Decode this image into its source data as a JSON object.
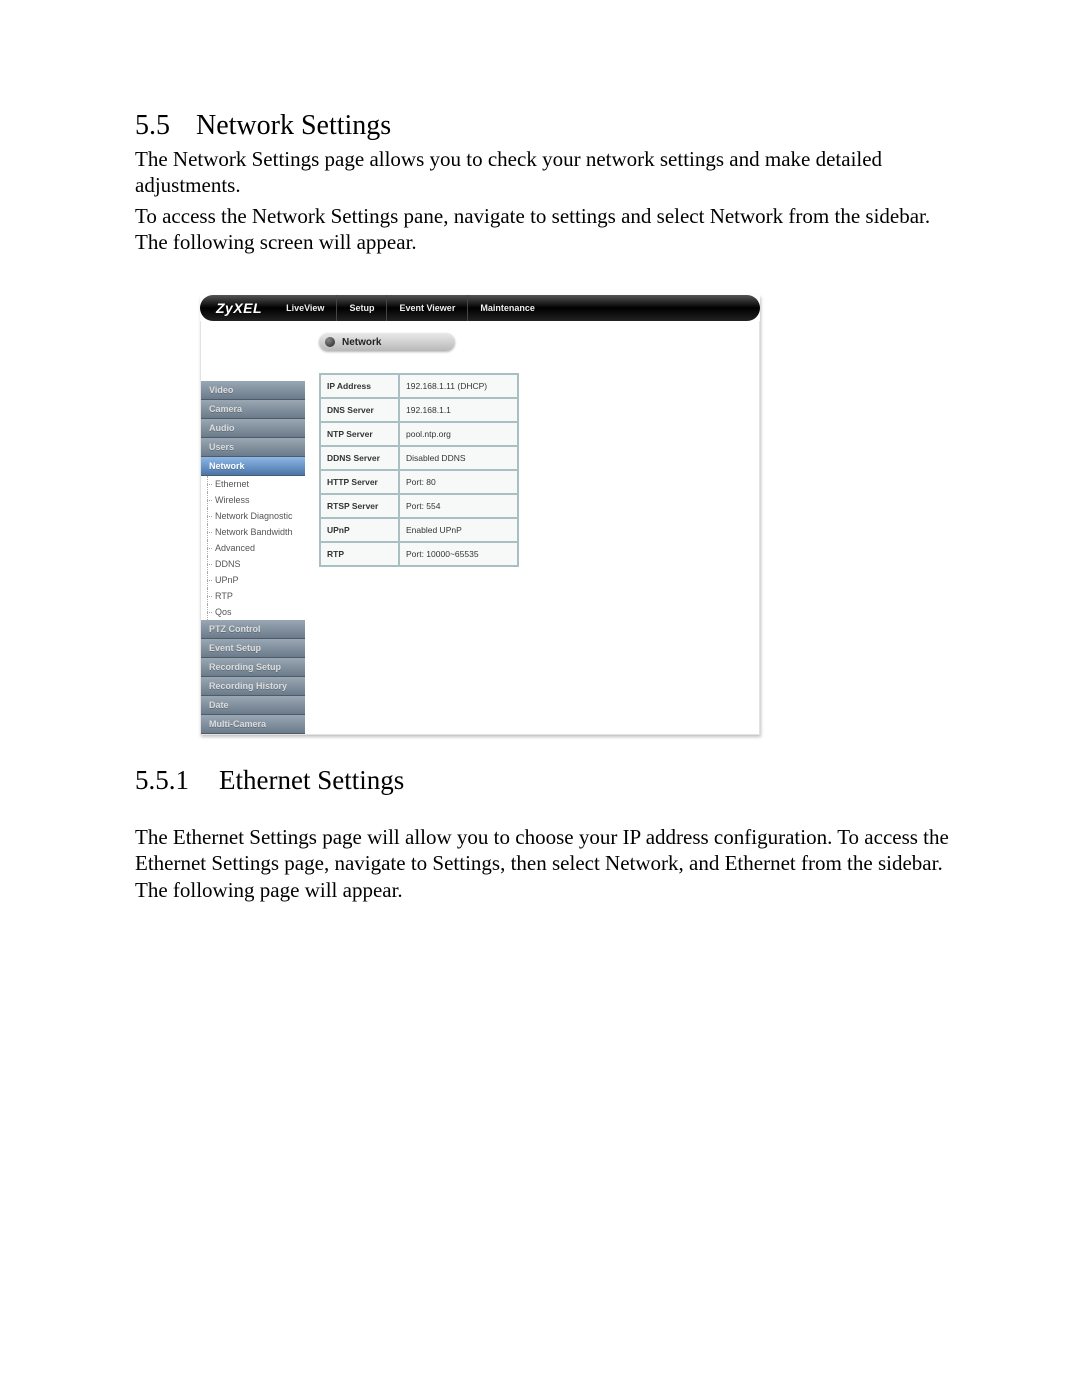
{
  "doc": {
    "sec_num": "5.5",
    "sec_title": "Network Settings",
    "para1": "The Network Settings page allows you to check your network settings and make detailed adjustments.",
    "para2": "To access the Network Settings pane, navigate to settings and select Network from the sidebar. The following screen will appear.",
    "subsec_num": "5.5.1",
    "subsec_title": "Ethernet Settings",
    "para3": "The Ethernet Settings page will allow you to choose your IP address configuration. To access the Ethernet Settings page, navigate to Settings, then select Network, and Ethernet from the sidebar. The following page will appear."
  },
  "ui": {
    "brand": "ZyXEL",
    "tabs": [
      "LiveView",
      "Setup",
      "Event Viewer",
      "Maintenance"
    ],
    "sidebar": {
      "items": [
        {
          "label": "Video"
        },
        {
          "label": "Camera"
        },
        {
          "label": "Audio"
        },
        {
          "label": "Users"
        },
        {
          "label": "Network",
          "active": true
        },
        {
          "label": "PTZ Control"
        },
        {
          "label": "Event Setup"
        },
        {
          "label": "Recording Setup"
        },
        {
          "label": "Recording History"
        },
        {
          "label": "Date"
        },
        {
          "label": "Multi-Camera"
        }
      ],
      "network_sub": [
        "Ethernet",
        "Wireless",
        "Network Diagnostic",
        "Network Bandwidth",
        "Advanced",
        "DDNS",
        "UPnP",
        "RTP",
        "Qos"
      ]
    },
    "content": {
      "header": "Network",
      "rows": [
        {
          "k": "IP Address",
          "v": "192.168.1.11 (DHCP)"
        },
        {
          "k": "DNS Server",
          "v": "192.168.1.1"
        },
        {
          "k": "NTP Server",
          "v": "pool.ntp.org"
        },
        {
          "k": "DDNS Server",
          "v": "Disabled DDNS"
        },
        {
          "k": "HTTP Server",
          "v": "Port: 80"
        },
        {
          "k": "RTSP Server",
          "v": "Port: 554"
        },
        {
          "k": "UPnP",
          "v": "Enabled UPnP"
        },
        {
          "k": "RTP",
          "v": "Port: 10000~65535"
        }
      ]
    }
  }
}
